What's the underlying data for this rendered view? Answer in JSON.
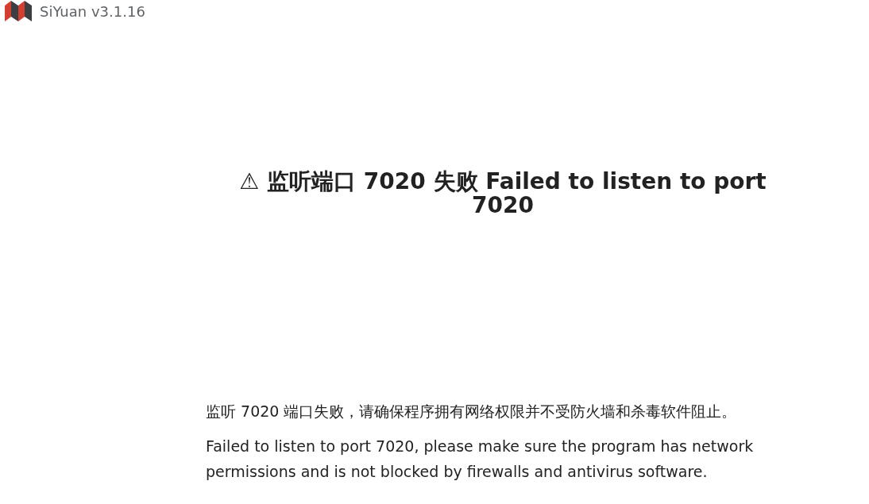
{
  "window": {
    "title": "SiYuan v3.1.16"
  },
  "heading": "⚠ 监听端口 7020 失败 Failed to listen to port 7020",
  "paragraphs": [
    "监听 7020 端口失败，请确保程序拥有网络权限并不受防火墙和杀毒软件阻止。",
    "Failed to listen to port 7020, please make sure the program has network permissions and is not blocked by firewalls and antivirus software."
  ]
}
